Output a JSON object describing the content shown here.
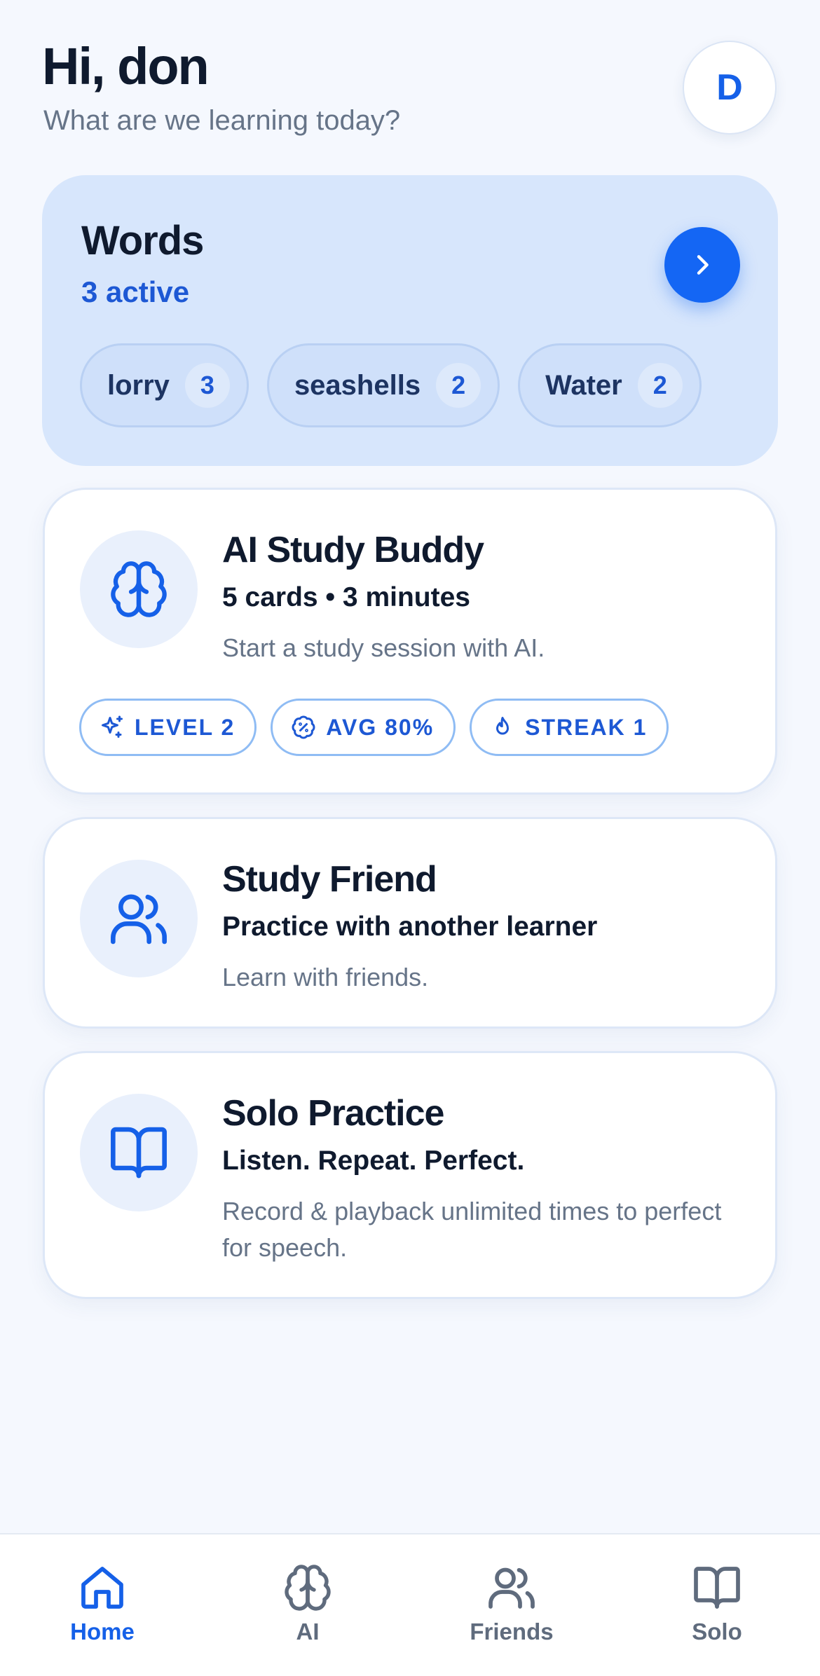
{
  "header": {
    "greeting": "Hi, don",
    "subtitle": "What are we learning today?",
    "avatar_initial": "D"
  },
  "words": {
    "title": "Words",
    "active_label": "3 active",
    "chips": [
      {
        "word": "lorry",
        "count": "3"
      },
      {
        "word": "seashells",
        "count": "2"
      },
      {
        "word": "Water",
        "count": "2"
      }
    ]
  },
  "cards": {
    "ai_buddy": {
      "title": "AI Study Buddy",
      "subtitle": "5 cards • 3 minutes",
      "description": "Start a study session with AI.",
      "icon": "brain-icon",
      "badges": [
        {
          "icon": "sparkle-icon",
          "label": "LEVEL 2"
        },
        {
          "icon": "percent-badge-icon",
          "label": "AVG 80%"
        },
        {
          "icon": "flame-icon",
          "label": "STREAK 1"
        }
      ]
    },
    "study_friend": {
      "title": "Study Friend",
      "subtitle": "Practice with another learner",
      "description": "Learn with friends.",
      "icon": "users-icon"
    },
    "solo_practice": {
      "title": "Solo Practice",
      "subtitle": "Listen. Repeat. Perfect.",
      "description": "Record & playback unlimited times to perfect for speech.",
      "icon": "book-open-icon"
    }
  },
  "nav": {
    "items": [
      {
        "label": "Home",
        "icon": "home-icon",
        "active": true
      },
      {
        "label": "AI",
        "icon": "brain-icon",
        "active": false
      },
      {
        "label": "Friends",
        "icon": "users-icon",
        "active": false
      },
      {
        "label": "Solo",
        "icon": "book-open-icon",
        "active": false
      }
    ]
  },
  "colors": {
    "accent": "#1466f4",
    "accent_text": "#1d58d4",
    "background": "#f5f8fe",
    "words_card": "#d7e6fc",
    "muted_text": "#667488"
  }
}
